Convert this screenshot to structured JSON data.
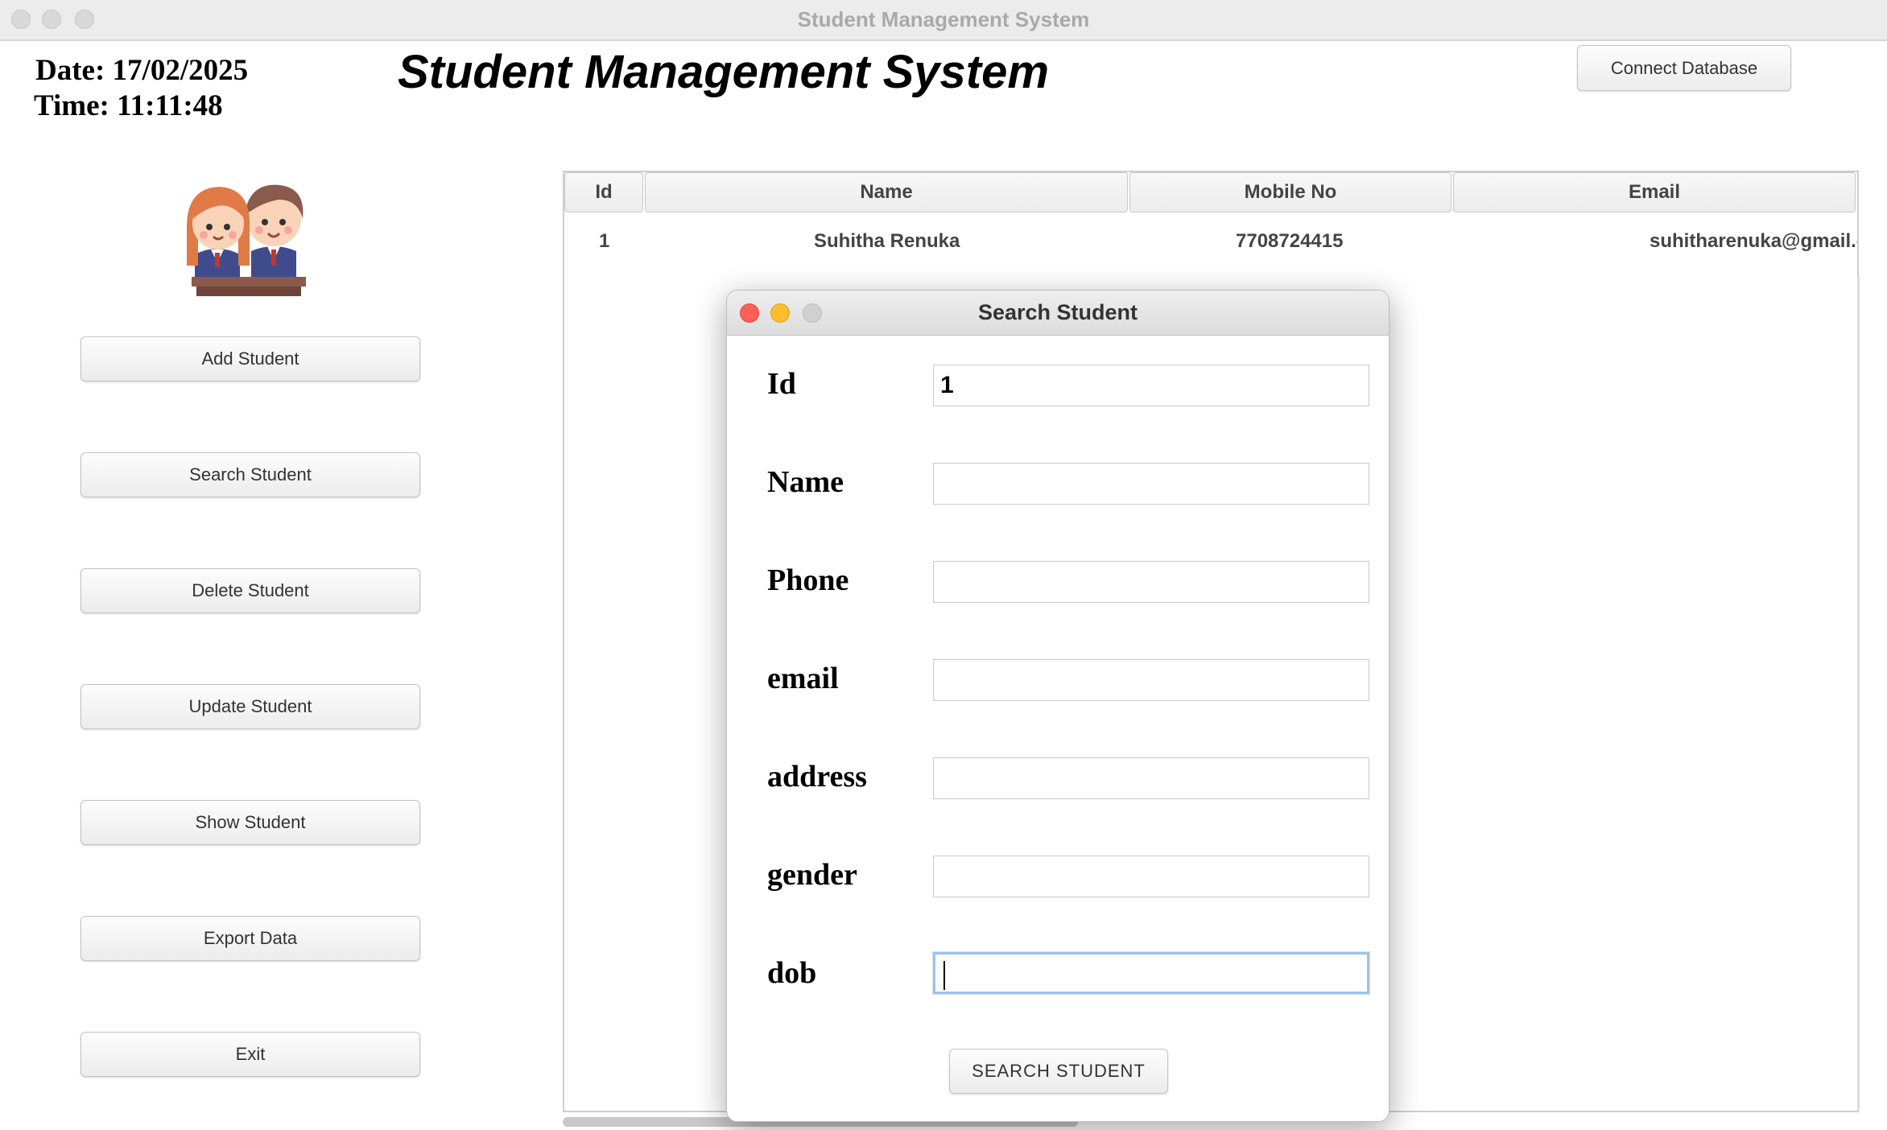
{
  "window": {
    "title": "Student Management System"
  },
  "header": {
    "date": "Date: 17/02/2025",
    "time": "Time: 11:11:48",
    "app_title": "Student Management System",
    "connect_label": "Connect Database"
  },
  "sidebar": {
    "items": [
      {
        "label": "Add Student"
      },
      {
        "label": "Search Student"
      },
      {
        "label": "Delete Student"
      },
      {
        "label": "Update Student"
      },
      {
        "label": "Show Student"
      },
      {
        "label": "Export Data"
      },
      {
        "label": "Exit"
      }
    ]
  },
  "table": {
    "columns": [
      "Id",
      "Name",
      "Mobile No",
      "Email"
    ],
    "rows": [
      {
        "id": "1",
        "name": "Suhitha Renuka",
        "mobile": "7708724415",
        "email": "suhitharenuka@gmail.c"
      }
    ]
  },
  "dialog": {
    "title": "Search Student",
    "fields": [
      {
        "label": "Id",
        "value": "1"
      },
      {
        "label": "Name",
        "value": ""
      },
      {
        "label": "Phone",
        "value": ""
      },
      {
        "label": "email",
        "value": ""
      },
      {
        "label": "address",
        "value": ""
      },
      {
        "label": "gender",
        "value": ""
      },
      {
        "label": "dob",
        "value": ""
      }
    ],
    "submit_label": "SEARCH STUDENT"
  },
  "icons": {
    "avatar": "students-avatar-icon"
  }
}
